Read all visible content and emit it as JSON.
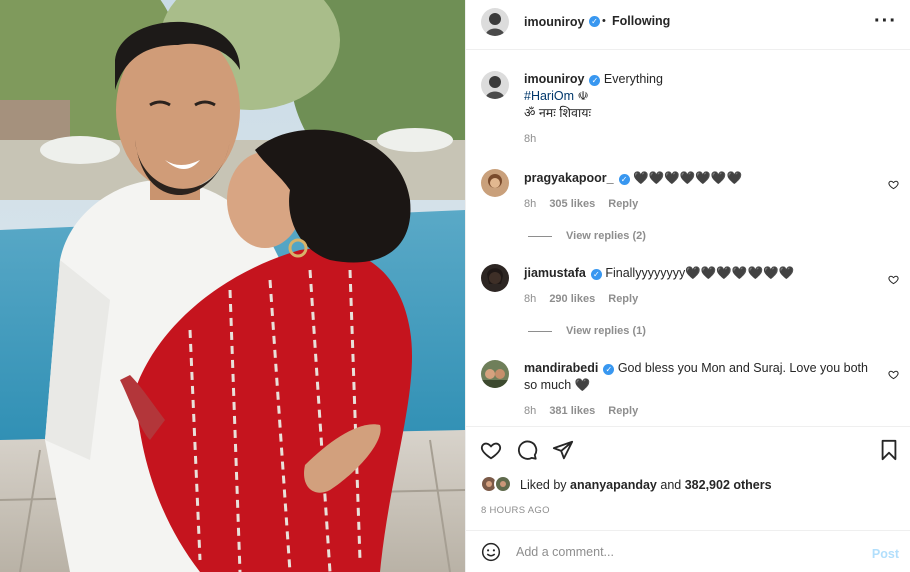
{
  "header": {
    "username": "imouniroy",
    "separator": "•",
    "follow_state": "Following",
    "more_icon": "more-options-icon"
  },
  "caption": {
    "username": "imouniroy",
    "text": "Everything",
    "hashtag": "#HariOm",
    "symbol": "☫",
    "line3": "ॐ नमः शिवायः",
    "time": "8h"
  },
  "comments": [
    {
      "username": "pragyakapoor_",
      "text": "🖤🖤🖤🖤🖤🖤🖤",
      "time": "8h",
      "likes": "305 likes",
      "reply": "Reply",
      "view_replies": "View replies (2)"
    },
    {
      "username": "jiamustafa",
      "text": "Finallyyyyyyyy🖤🖤🖤🖤🖤🖤🖤",
      "time": "8h",
      "likes": "290 likes",
      "reply": "Reply",
      "view_replies": "View replies (1)"
    },
    {
      "username": "mandirabedi",
      "text": "God bless you Mon and Suraj. Love you both so much 🖤",
      "time": "8h",
      "likes": "381 likes",
      "reply": "Reply"
    }
  ],
  "likes": {
    "prefix": "Liked by",
    "user": "ananyapanday",
    "and": "and",
    "others": "382,902 others"
  },
  "timestamp": "8 HOURS AGO",
  "add_comment": {
    "placeholder": "Add a comment...",
    "post_label": "Post"
  },
  "colors": {
    "verified": "#3897f0",
    "hashtag": "#00376b",
    "post_disabled": "#b2dffc",
    "muted": "#8e8e8e"
  }
}
